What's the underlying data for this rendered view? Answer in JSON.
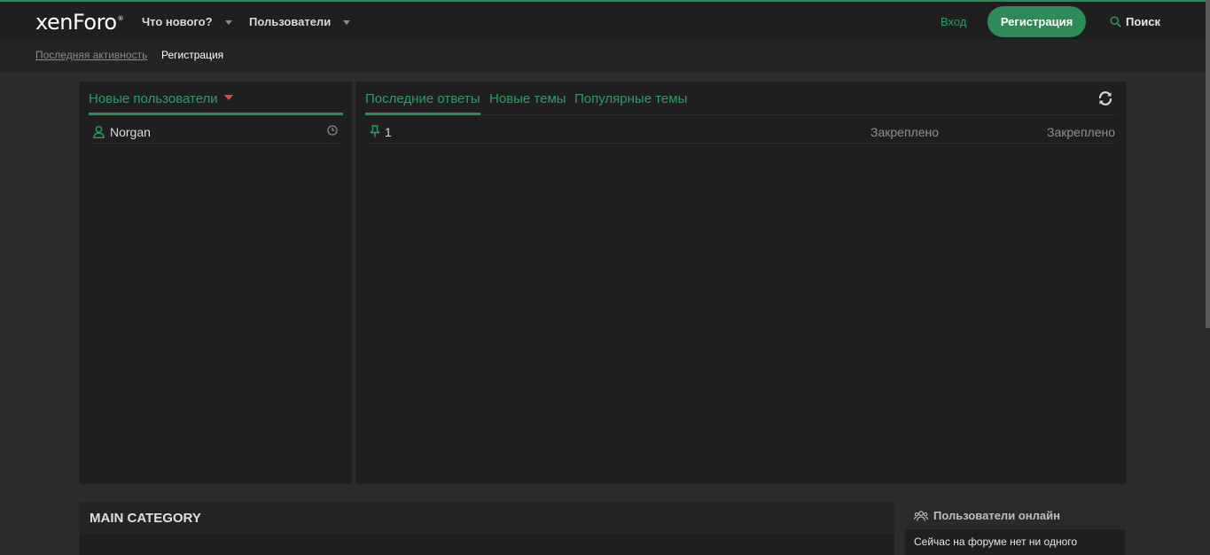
{
  "header": {
    "logo": "xenForo",
    "logo_mark": "®",
    "nav": [
      {
        "label": "Что нового?"
      },
      {
        "label": "Пользователи"
      }
    ],
    "login_label": "Вход",
    "register_label": "Регистрация",
    "search_label": "Поиск"
  },
  "breadcrumb": {
    "link": "Последняя активность",
    "current": "Регистрация"
  },
  "new_users": {
    "title": "Новые пользователи",
    "users": [
      {
        "name": "Norgan"
      }
    ]
  },
  "threads": {
    "tabs": [
      {
        "label": "Последние ответы"
      },
      {
        "label": "Новые темы"
      },
      {
        "label": "Популярные темы"
      }
    ],
    "rows": [
      {
        "title": "1",
        "col1": "Закреплено",
        "col2": "Закреплено"
      }
    ]
  },
  "category": {
    "title": "MAIN CATEGORY"
  },
  "online": {
    "title": "Пользователи онлайн",
    "text": "Сейчас на форуме нет ни одного"
  },
  "colors": {
    "accent": "#2e8b57",
    "link_green": "#2e9e64",
    "alert_red": "#e04848"
  }
}
